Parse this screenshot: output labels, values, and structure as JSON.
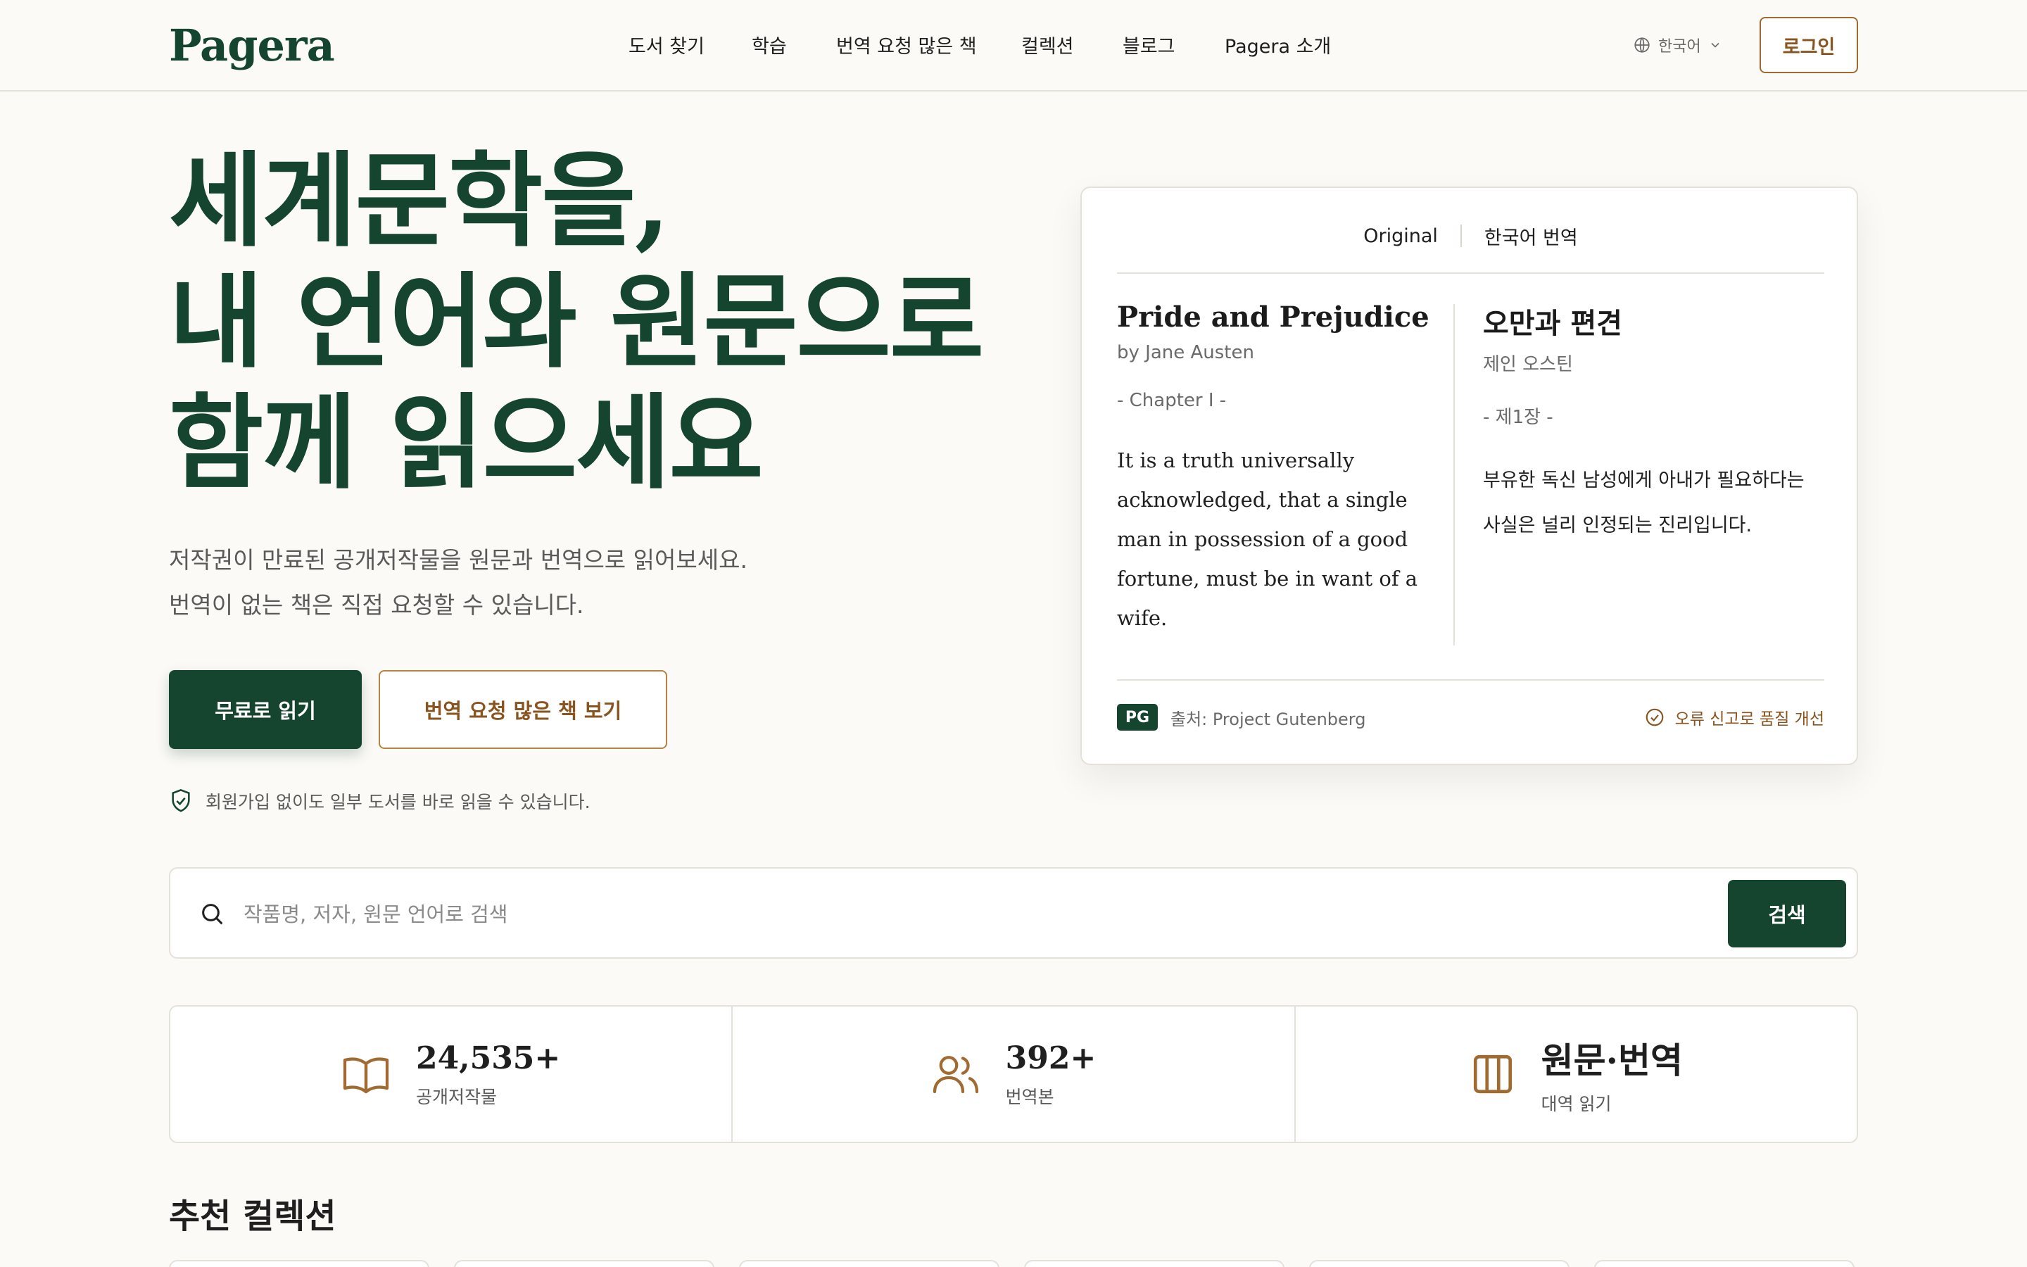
{
  "header": {
    "logo": "Pagera",
    "nav": [
      {
        "label": "도서 찾기"
      },
      {
        "label": "학습"
      },
      {
        "label": "번역 요청 많은 책"
      },
      {
        "label": "컬렉션"
      },
      {
        "label": "블로그"
      },
      {
        "label": "Pagera 소개"
      }
    ],
    "language": "한국어",
    "login_label": "로그인"
  },
  "hero": {
    "title_lines": [
      "세계문학을,",
      "내 언어와 원문으로",
      "함께 읽으세요"
    ],
    "subtitle_lines": [
      "저작권이 만료된 공개저작물을 원문과 번역으로 읽어보세요.",
      "번역이 없는 책은 직접 요청할 수 있습니다."
    ],
    "primary_cta": "무료로 읽기",
    "secondary_cta": "번역 요청 많은 책 보기",
    "note": "회원가입 없이도 일부 도서를 바로 읽을 수 있습니다."
  },
  "preview": {
    "tab_original": "Original",
    "tab_translation": "한국어 번역",
    "original": {
      "title": "Pride and Prejudice",
      "author": "by Jane Austen",
      "chapter": "- Chapter I -",
      "passage": "It is a truth universally acknowledged, that a single man in possession of a good fortune, must be in want of a wife."
    },
    "translation": {
      "title": "오만과 편견",
      "author": "제인 오스틴",
      "chapter": "- 제1장 -",
      "passage": "부유한 독신 남성에게 아내가 필요하다는 사실은 널리 인정되는 진리입니다."
    },
    "badge": "PG",
    "source": "출처: Project Gutenberg",
    "report": "오류 신고로 품질 개선"
  },
  "search": {
    "placeholder": "작품명, 저자, 원문 언어로 검색",
    "button": "검색"
  },
  "stats": [
    {
      "icon": "book-open-icon",
      "value": "24,535+",
      "label": "공개저작물"
    },
    {
      "icon": "users-icon",
      "value": "392+",
      "label": "번역본"
    },
    {
      "icon": "columns-icon",
      "value": "원문·번역",
      "label": "대역 읽기"
    }
  ],
  "recommended": {
    "title": "추천 컬렉션"
  },
  "colors": {
    "brand_green": "#15452f",
    "accent_brown": "#8a5420",
    "background": "#fbfaf6",
    "border": "#e4e1d8"
  }
}
